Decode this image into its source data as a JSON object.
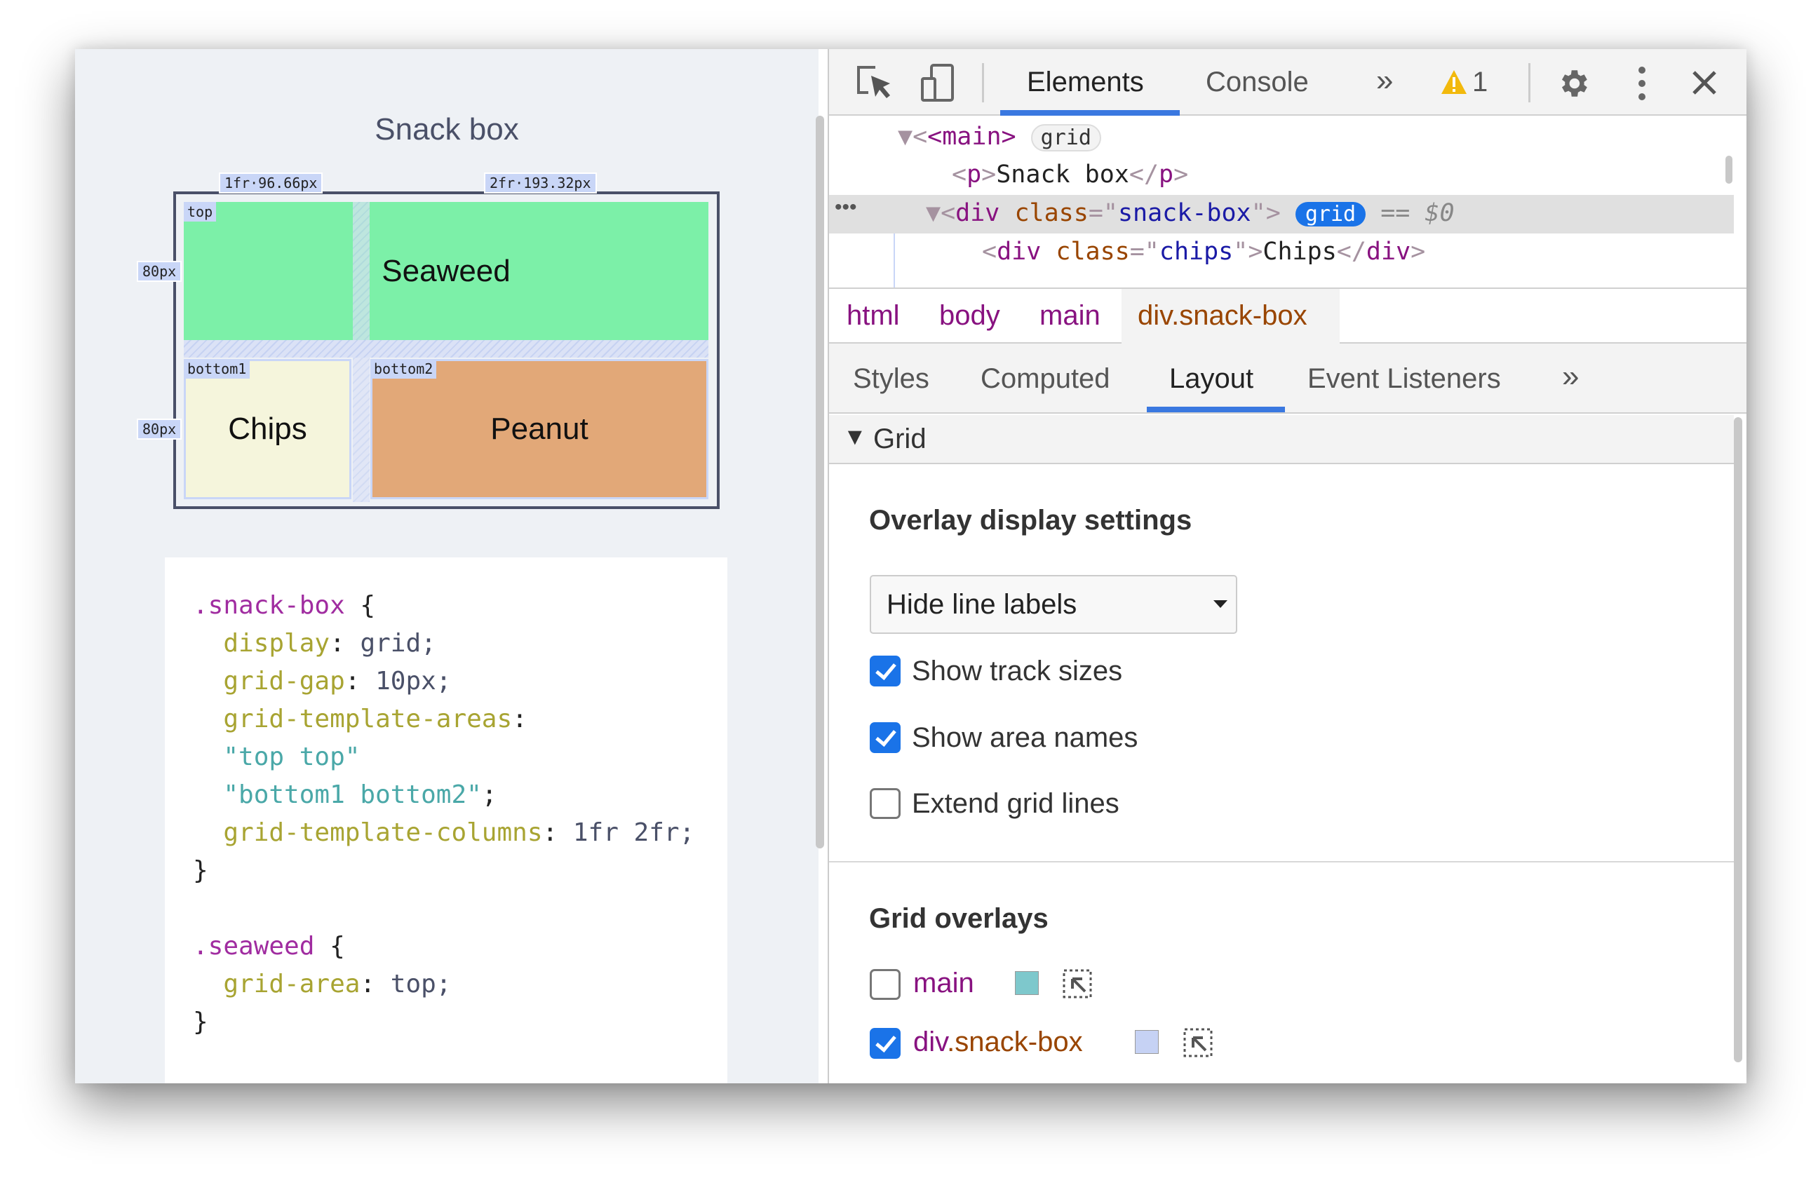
{
  "page": {
    "title": "Snack box",
    "grid": {
      "col_labels": [
        "1fr·96.66px",
        "2fr·193.32px"
      ],
      "row_labels": [
        "80px",
        "80px"
      ],
      "areas": [
        "top",
        "bottom1",
        "bottom2"
      ],
      "cells": {
        "seaweed": "Seaweed",
        "chips": "Chips",
        "peanut": "Peanut"
      },
      "colors": {
        "seaweed": "#7cf0a8",
        "chips": "#f5f5dc",
        "peanut": "#e2a878",
        "overlay": "#c9d6f7"
      }
    },
    "code": [
      [
        [
          ".snack-box",
          "sel"
        ],
        [
          " {",
          "tx"
        ]
      ],
      [
        [
          "  display",
          "prop"
        ],
        [
          ": ",
          "tx"
        ],
        [
          "grid;",
          "val"
        ]
      ],
      [
        [
          "  grid-gap",
          "prop"
        ],
        [
          ": ",
          "tx"
        ],
        [
          "10px;",
          "val"
        ]
      ],
      [
        [
          "  grid-template-areas",
          "prop"
        ],
        [
          ":",
          "tx"
        ]
      ],
      [
        [
          "  \"top top\"",
          "str"
        ]
      ],
      [
        [
          "  \"bottom1 bottom2\"",
          "str"
        ],
        [
          ";",
          "tx"
        ]
      ],
      [
        [
          "  grid-template-columns",
          "prop"
        ],
        [
          ": ",
          "tx"
        ],
        [
          "1fr 2fr;",
          "val"
        ]
      ],
      [
        [
          "}",
          "tx"
        ]
      ],
      [],
      [
        [
          ".seaweed",
          "sel"
        ],
        [
          " {",
          "tx"
        ]
      ],
      [
        [
          "  grid-area",
          "prop"
        ],
        [
          ": ",
          "tx"
        ],
        [
          "top;",
          "val"
        ]
      ],
      [
        [
          "}",
          "tx"
        ]
      ]
    ]
  },
  "devtools": {
    "toolbar": {
      "tabs": [
        "Elements",
        "Console"
      ],
      "more": "»",
      "warning_count": "1",
      "active": "Elements"
    },
    "dom": {
      "main_open": "<main>",
      "main_badge": "grid",
      "p_line": "Snack box",
      "div_tag": "div",
      "div_attr": "class",
      "div_val": "snack-box",
      "div_badge": "grid",
      "selected_suffix": "== $0",
      "chips_val": "chips",
      "chips_text": "Chips",
      "dots": "•••"
    },
    "breadcrumb": [
      "html",
      "body",
      "main",
      "div.snack-box"
    ],
    "panel_tabs": [
      "Styles",
      "Computed",
      "Layout",
      "Event Listeners"
    ],
    "panel_more": "»",
    "active_panel_tab": "Layout",
    "layout": {
      "section": "Grid",
      "overlay_heading": "Overlay display settings",
      "select_value": "Hide line labels",
      "options": [
        {
          "label": "Show track sizes",
          "checked": true
        },
        {
          "label": "Show area names",
          "checked": true
        },
        {
          "label": "Extend grid lines",
          "checked": false
        }
      ],
      "overlays_heading": "Grid overlays",
      "overlays": [
        {
          "tag": "main",
          "cls": "",
          "checked": false,
          "color": "#7ec8cc"
        },
        {
          "tag": "div",
          "cls": ".snack-box",
          "checked": true,
          "color": "#c6d2f4"
        }
      ]
    }
  }
}
